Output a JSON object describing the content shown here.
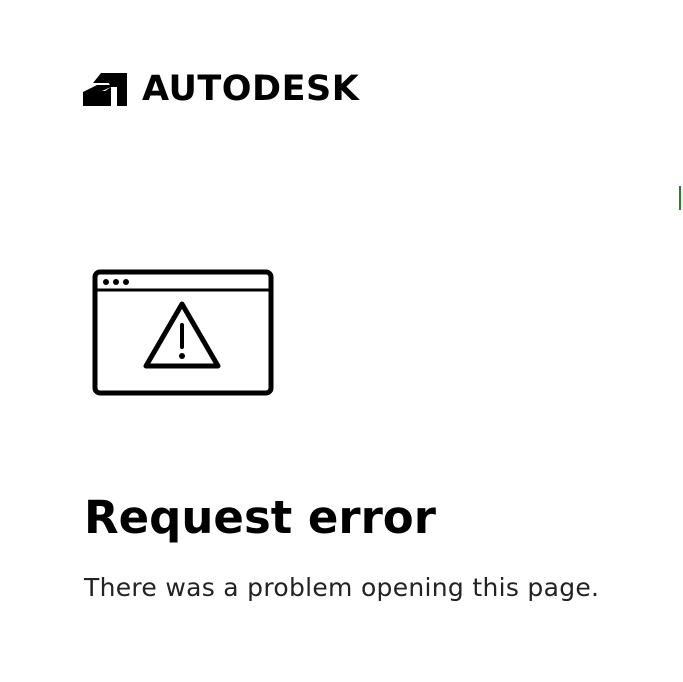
{
  "brand": {
    "name": "AUTODESK",
    "logo_icon": "autodesk-logo-mark"
  },
  "error": {
    "icon": "browser-window-warning-icon",
    "title": "Request error",
    "message": "There was a problem opening this page."
  },
  "colors": {
    "background": "#ffffff",
    "text": "#000000",
    "edge_mark": "#2e7d32"
  }
}
